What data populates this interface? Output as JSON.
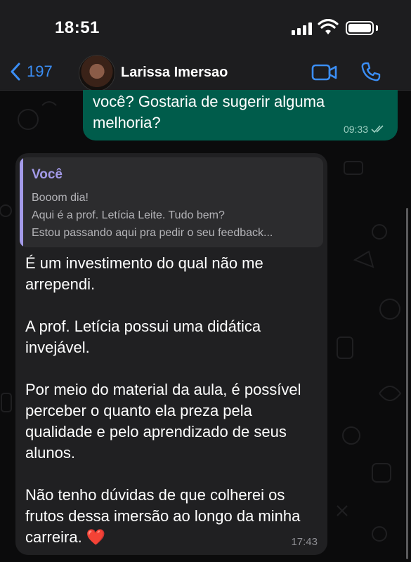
{
  "status_bar": {
    "time": "18:51"
  },
  "header": {
    "back_count": "197",
    "contact_name": "Larissa Imersao"
  },
  "messages": {
    "outgoing": {
      "lines": [
        "você? Gostaria de sugerir alguma",
        "melhoria?"
      ],
      "time": "09:33"
    },
    "incoming": {
      "quote_author": "Você",
      "quote_lines": [
        "Booom dia!",
        "Aqui é a prof. Letícia Leite. Tudo bem?",
        "Estou passando aqui pra pedir o seu feedback..."
      ],
      "paragraphs": [
        "É um investimento do qual não me arrependi.",
        "A prof. Letícia possui uma didática invejável.",
        "Por meio do material da aula, é possível perceber o quanto ela preza pela qualidade e pelo aprendizado de seus alunos.",
        "Não tenho dúvidas de que colherei os frutos dessa imersão ao longo da minha carreira."
      ],
      "emoji": "❤️",
      "time": "17:43"
    }
  },
  "colors": {
    "accent_blue": "#3b8ef5",
    "outgoing_bubble": "#005c4b",
    "incoming_bubble": "#202022",
    "quote_accent": "#a39ae8"
  },
  "icons": [
    "chevron-left-icon",
    "video-camera-icon",
    "phone-icon",
    "read-receipt-icon",
    "wifi-icon",
    "battery-icon"
  ]
}
